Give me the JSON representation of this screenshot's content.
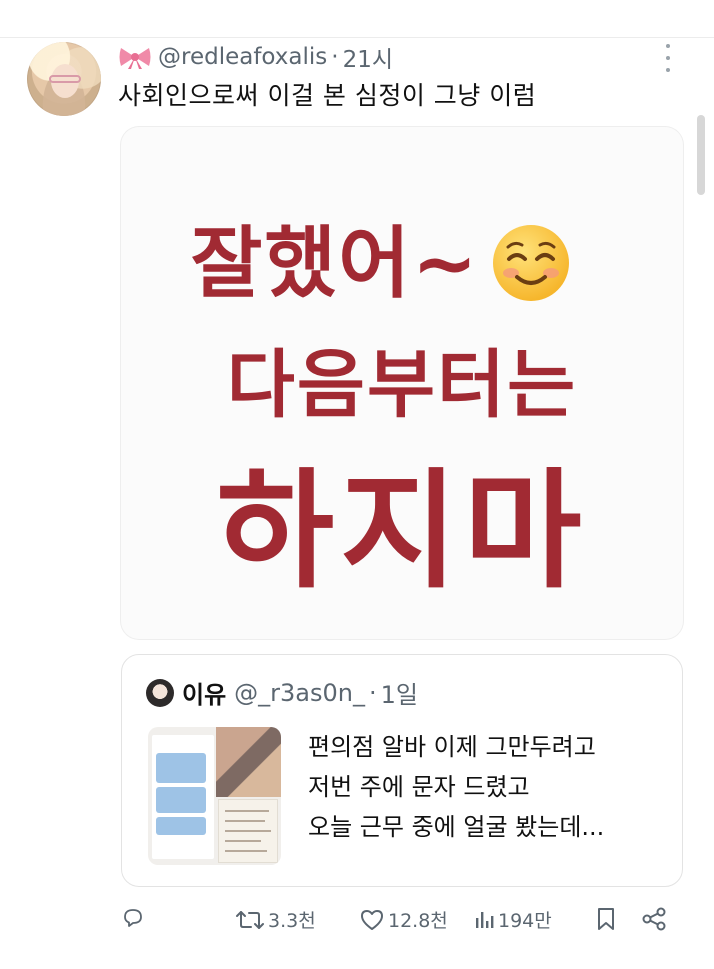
{
  "post": {
    "display_emoji": "🎀",
    "handle": "@redleafoxalis",
    "separator": "·",
    "time": "21시",
    "text": "사회인으로써 이걸 본 심정이 그냥 이럼"
  },
  "media": {
    "line1": "잘했어~",
    "line2": "다음부터는",
    "line3": "하지마",
    "text_color": "#a12a33",
    "emoji": "smiling-face-with-smiling-eyes"
  },
  "quote": {
    "name": "이유",
    "handle": "@_r3as0n_",
    "separator": "·",
    "time": "1일",
    "lines": [
      "편의점 알바 이제 그만두려고",
      "저번 주에 문자 드렸고",
      "오늘 근무 중에 얼굴 봤는데..."
    ]
  },
  "actions": {
    "retweets": "3.3천",
    "likes": "12.8천",
    "views": "194만"
  },
  "colors": {
    "secondary_text": "#5b6670",
    "border": "#e3e3e3"
  }
}
